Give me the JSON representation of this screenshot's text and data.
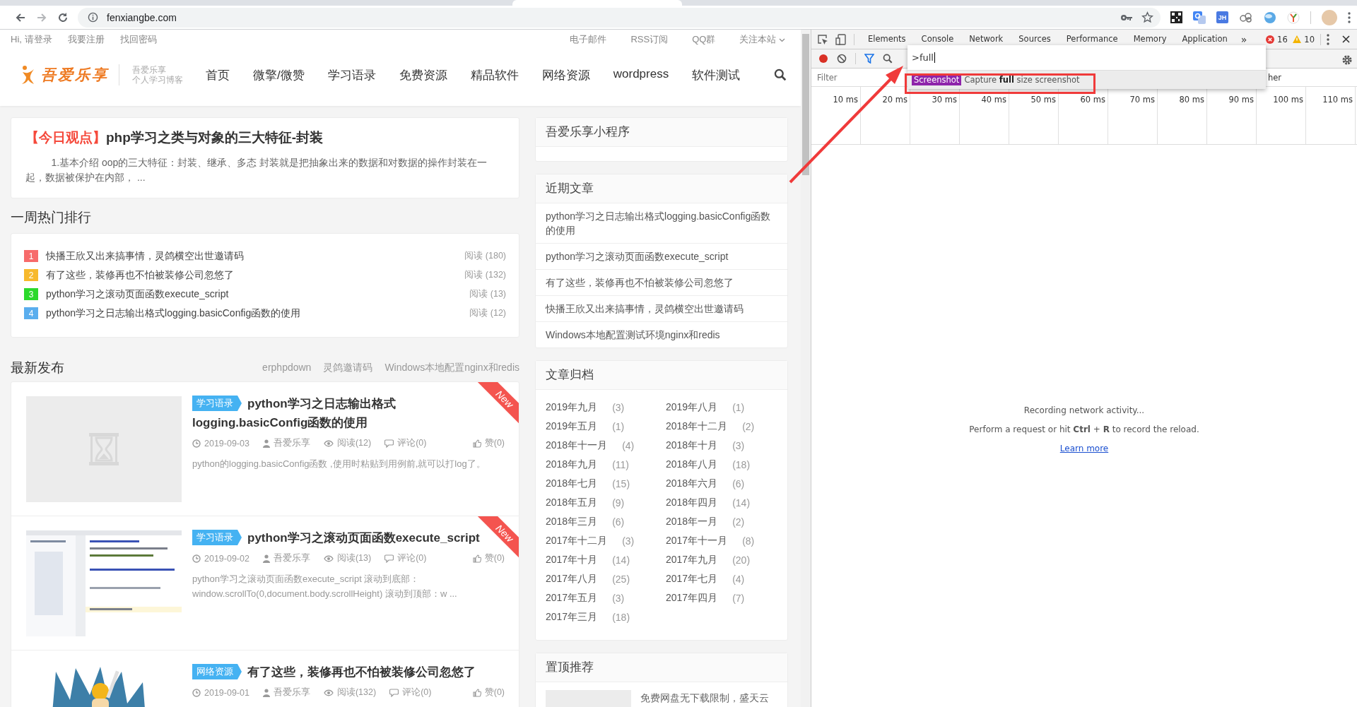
{
  "browser": {
    "url": "fenxiangbe.com",
    "extension_label": "JH"
  },
  "site": {
    "top_links_left": [
      "Hi, 请登录",
      "我要注册",
      "找回密码"
    ],
    "top_links_right": [
      "电子邮件",
      "RSS订阅",
      "QQ群",
      "关注本站"
    ],
    "logo": {
      "name": "吾爱乐享",
      "tagline_1": "吾爱乐享",
      "tagline_2": "个人学习博客"
    },
    "nav": [
      "首页",
      "微擎/微赞",
      "学习语录",
      "免费资源",
      "精品软件",
      "网络资源",
      "wordpress",
      "软件测试"
    ],
    "featured": {
      "tag": "【今日观点】",
      "title": "php学习之类与对象的三大特征-封装",
      "excerpt": "1.基本介绍 oop的三大特征：封装、继承、多态 封装就是把抽象出来的数据和对数据的操作封装在一起，数据被保护在内部， ..."
    },
    "hot": {
      "title": "一周热门排行",
      "items": [
        {
          "rank": "1",
          "title": "快播王欣又出来搞事情，灵鸽横空出世邀请码",
          "reads": "阅读 (180)",
          "color": "#f76b6b"
        },
        {
          "rank": "2",
          "title": "有了这些，装修再也不怕被装修公司忽悠了",
          "reads": "阅读 (132)",
          "color": "#f7b92c"
        },
        {
          "rank": "3",
          "title": "python学习之滚动页面函数execute_script",
          "reads": "阅读 (13)",
          "color": "#2bd92b"
        },
        {
          "rank": "4",
          "title": "python学习之日志输出格式logging.basicConfig函数的使用",
          "reads": "阅读 (12)",
          "color": "#5aaeee"
        }
      ]
    },
    "latest": {
      "title": "最新发布",
      "links": [
        "erphpdown",
        "灵鸽邀请码",
        "Windows本地配置nginx和redis"
      ],
      "posts": [
        {
          "thumbnail": {
            "kind": "placeholder"
          },
          "category": "学习语录",
          "title": "python学习之日志输出格式logging.basicConfig函数的使用",
          "date": "2019-09-03",
          "author": "吾爱乐享",
          "reads": "阅读(12)",
          "comments": "评论(0)",
          "likes": "赞(0)",
          "excerpt": "python的logging.basicConfig函数 ,使用时粘贴到用例前,就可以打log了。",
          "ribbon": "New"
        },
        {
          "category": "学习语录",
          "title": "python学习之滚动页面函数execute_script",
          "date": "2019-09-02",
          "author": "吾爱乐享",
          "reads": "阅读(13)",
          "comments": "评论(0)",
          "likes": "赞(0)",
          "excerpt": "python学习之滚动页面函数execute_script 滚动到底部：window.scrollTo(0,document.body.scrollHeight) 滚动到顶部：w ...",
          "ribbon": "New"
        },
        {
          "category": "网络资源",
          "title": "有了这些，装修再也不怕被装修公司忽悠了",
          "date": "2019-09-01",
          "author": "吾爱乐享",
          "reads": "阅读(132)",
          "comments": "评论(0)",
          "likes": "赞(0)"
        }
      ]
    },
    "sidebar": {
      "mini_program": {
        "title": "吾爱乐享小程序"
      },
      "recent": {
        "title": "近期文章",
        "items": [
          "python学习之日志输出格式logging.basicConfig函数的使用",
          "python学习之滚动页面函数execute_script",
          "有了这些，装修再也不怕被装修公司忽悠了",
          "快播王欣又出来搞事情，灵鸽横空出世邀请码",
          "Windows本地配置测试环境nginx和redis"
        ]
      },
      "archive": {
        "title": "文章归档",
        "items": [
          {
            "month": "2019年九月",
            "count": "(3)"
          },
          {
            "month": "2019年八月",
            "count": "(1)"
          },
          {
            "month": "2019年五月",
            "count": "(1)"
          },
          {
            "month": "2018年十二月",
            "count": "(2)"
          },
          {
            "month": "2018年十一月",
            "count": "(4)"
          },
          {
            "month": "2018年十月",
            "count": "(3)"
          },
          {
            "month": "2018年九月",
            "count": "(11)"
          },
          {
            "month": "2018年八月",
            "count": "(18)"
          },
          {
            "month": "2018年七月",
            "count": "(15)"
          },
          {
            "month": "2018年六月",
            "count": "(6)"
          },
          {
            "month": "2018年五月",
            "count": "(9)"
          },
          {
            "month": "2018年四月",
            "count": "(14)"
          },
          {
            "month": "2018年三月",
            "count": "(6)"
          },
          {
            "month": "2018年一月",
            "count": "(2)"
          },
          {
            "month": "2017年十二月",
            "count": "(3)"
          },
          {
            "month": "2017年十一月",
            "count": "(8)"
          },
          {
            "month": "2017年十月",
            "count": "(14)"
          },
          {
            "month": "2017年九月",
            "count": "(20)"
          },
          {
            "month": "2017年八月",
            "count": "(25)"
          },
          {
            "month": "2017年七月",
            "count": "(4)"
          },
          {
            "month": "2017年五月",
            "count": "(3)"
          },
          {
            "month": "2017年四月",
            "count": "(7)"
          },
          {
            "month": "2017年三月",
            "count": "(18)"
          }
        ]
      },
      "pinned": {
        "title": "置顶推荐",
        "items": [
          {
            "thumbnail": {
              "kind": "blank"
            },
            "text": "免费网盘无下载限制，盛天云"
          }
        ]
      }
    }
  },
  "devtools": {
    "tabs": [
      "Elements",
      "Console",
      "Network",
      "Sources",
      "Performance",
      "Memory",
      "Application"
    ],
    "more": "»",
    "errors": "16",
    "warnings": "10",
    "command": {
      "value": ">full",
      "suggestion": {
        "badge": "Screenshot",
        "text": "Capture **full** size screenshot"
      }
    },
    "filter": {
      "placeholder": "Filter"
    },
    "hidden_fragment": "her",
    "timeline": [
      "10 ms",
      "20 ms",
      "30 ms",
      "40 ms",
      "50 ms",
      "60 ms",
      "70 ms",
      "80 ms",
      "90 ms",
      "100 ms",
      "110 ms"
    ],
    "status": {
      "line_1": "Recording network activity...",
      "line_2": "Perform a request or hit **Ctrl** + **R** to record the reload.",
      "link": "Learn more"
    }
  }
}
